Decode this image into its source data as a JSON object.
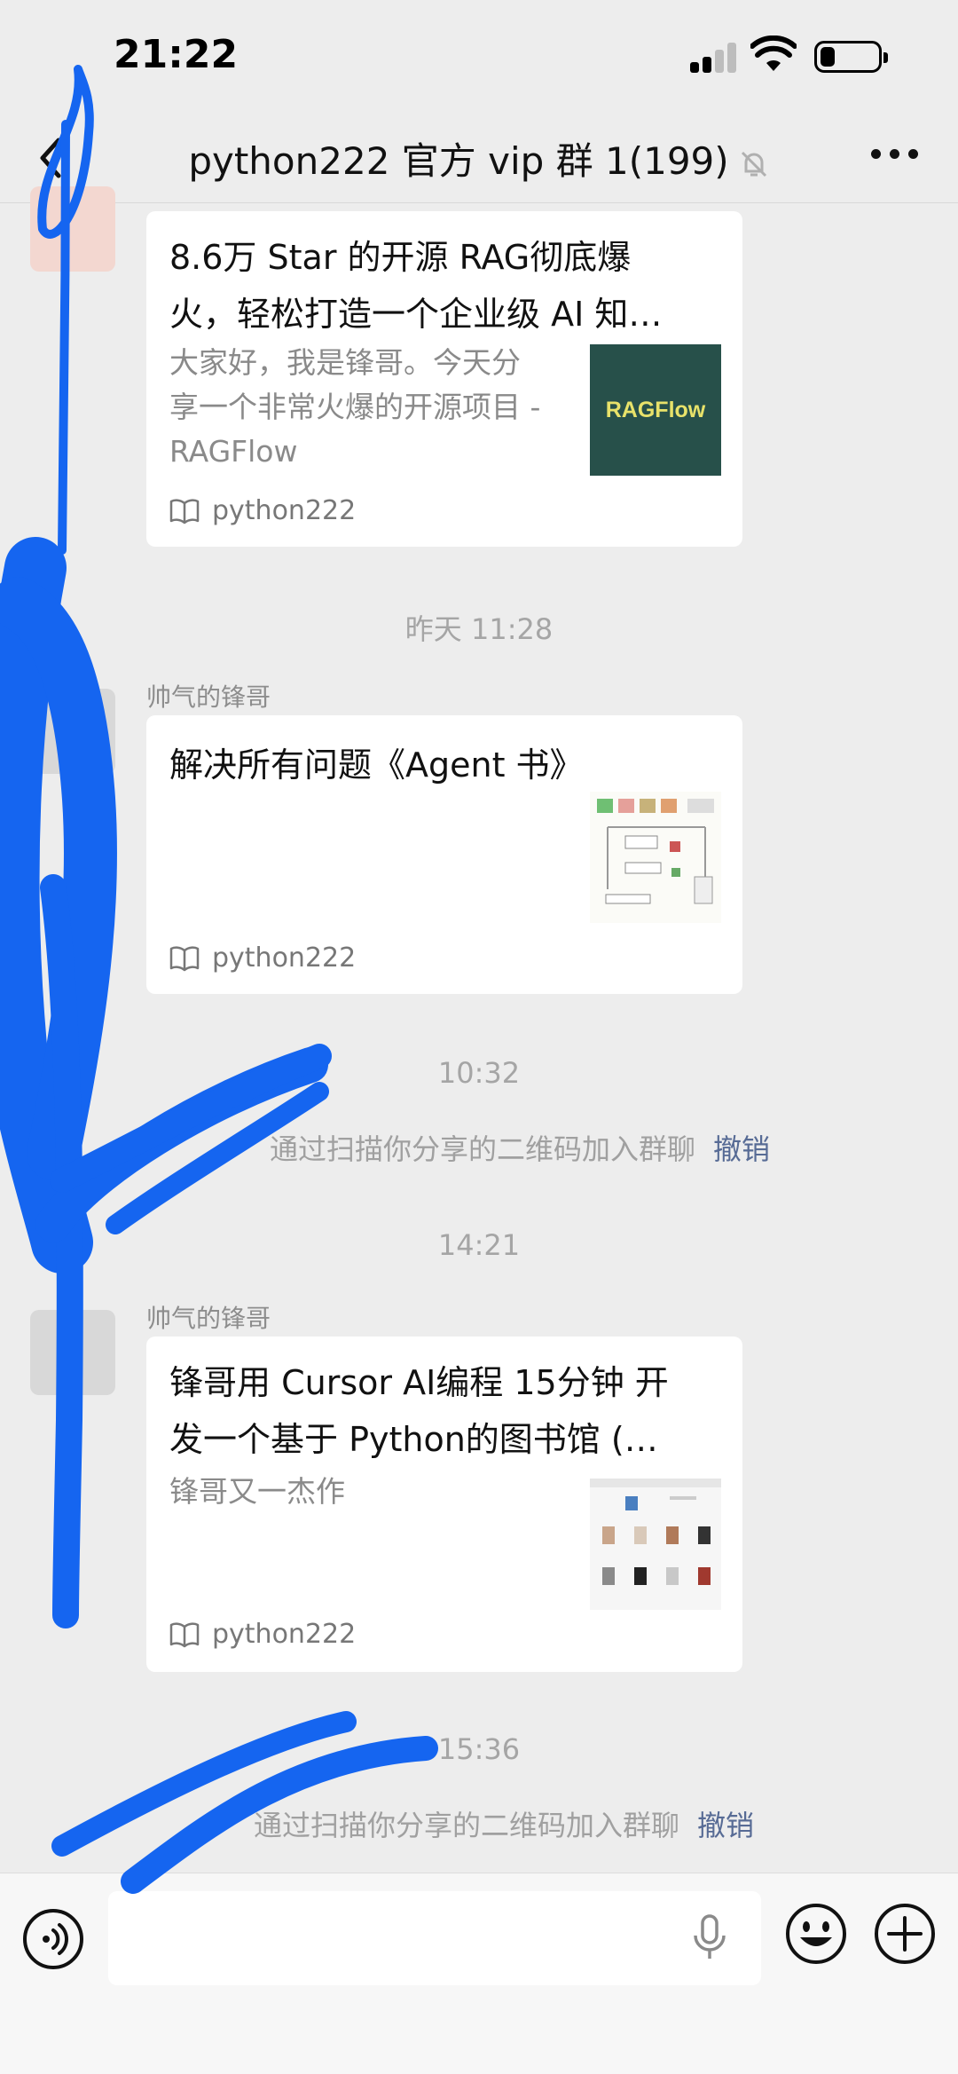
{
  "status_bar": {
    "time": "21:22",
    "battery_level": 0.25,
    "signal_bars": 2
  },
  "nav": {
    "title": "python222 官方 vip 群 1(199)",
    "back_icon": "chevron-left-icon",
    "mute_icon": "bell-slash-icon",
    "more_icon": "ellipsis-icon"
  },
  "messages": [
    {
      "type": "article",
      "title": "8.6万 Star 的开源 RAG彻底爆火，轻松打造一个企业级 AI 知…",
      "title_line1": "8.6万 Star 的开源 RAG彻底爆",
      "title_line2": "火，轻松打造一个企业级 AI 知…",
      "desc_line1": "大家好，我是锋哥。今天分",
      "desc_line2": "享一个非常火爆的开源项目 -",
      "desc_line3": "RAGFlow",
      "thumb_text": "RAGFlow",
      "source": "python222"
    },
    {
      "type": "timestamp",
      "text": "昨天 11:28"
    },
    {
      "type": "article",
      "sender": "帅气的锋哥",
      "title": "解决所有问题《Agent 书》",
      "source": "python222"
    },
    {
      "type": "timestamp",
      "text": "10:32"
    },
    {
      "type": "system",
      "text": "通过扫描你分享的二维码加入群聊",
      "action": "撤销"
    },
    {
      "type": "timestamp",
      "text": "14:21"
    },
    {
      "type": "article",
      "sender": "帅气的锋哥",
      "title_line1": "锋哥用 Cursor AI编程 15分钟 开",
      "title_line2": "发一个基于 Python的图书馆 (…",
      "desc": "锋哥又一杰作",
      "source": "python222"
    },
    {
      "type": "timestamp",
      "text": "15:36"
    },
    {
      "type": "system",
      "text": "通过扫描你分享的二维码加入群聊",
      "action": "撤销"
    }
  ],
  "input_bar": {
    "voice_icon": "voice-icon",
    "mic_icon": "microphone-icon",
    "emoji_icon": "smiley-icon",
    "plus_icon": "plus-circle-icon"
  },
  "colors": {
    "background": "#ededed",
    "card": "#ffffff",
    "link_blue": "#576b95",
    "scribble_blue": "#1565f0",
    "ragflow_thumb_bg": "#27504a",
    "ragflow_thumb_text": "#e8e26a"
  }
}
